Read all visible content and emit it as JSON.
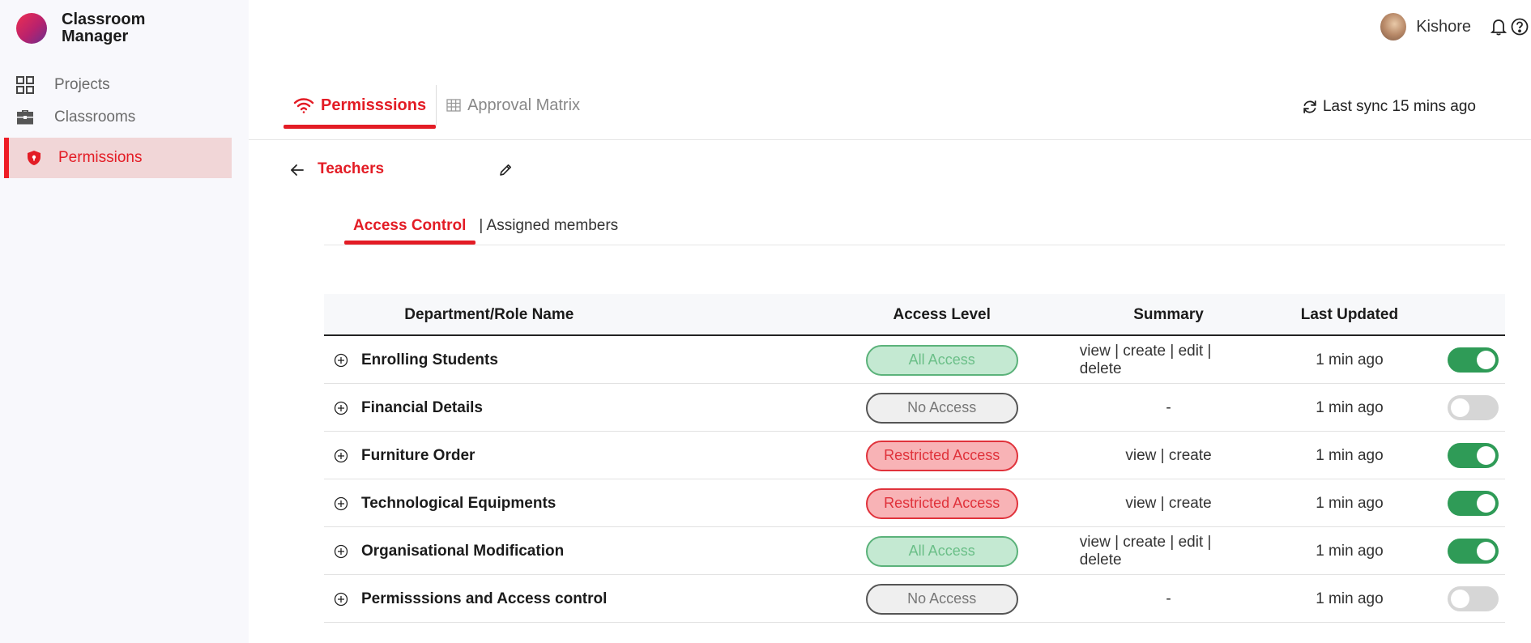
{
  "app": {
    "name": "Classroom Manager",
    "brand_color": "#e31c25"
  },
  "sidebar": {
    "items": [
      {
        "label": "Projects",
        "icon": "grid-icon",
        "active": false
      },
      {
        "label": "Classrooms",
        "icon": "briefcase-icon",
        "active": false
      },
      {
        "label": "Permissions",
        "icon": "shield-icon",
        "active": true
      }
    ]
  },
  "header": {
    "user_name": "Kishore",
    "icons": [
      "bell-icon",
      "help-icon"
    ]
  },
  "top_tabs": [
    {
      "label": "Permisssions",
      "icon": "wifi-icon",
      "active": true
    },
    {
      "label": "Approval Matrix",
      "icon": "table-icon",
      "active": false
    }
  ],
  "sync": {
    "text": "Last sync 15 mins ago"
  },
  "page": {
    "title": "Teachers"
  },
  "sub_tabs": [
    {
      "label": "Access Control",
      "active": true
    },
    {
      "label": "| Assigned members",
      "active": false
    }
  ],
  "table": {
    "columns": [
      "Department/Role Name",
      "Access Level",
      "Summary",
      "Last Updated"
    ],
    "rows": [
      {
        "name": "Enrolling Students",
        "access": "All Access",
        "access_type": "all",
        "summary": "view | create | edit | delete",
        "updated": "1 min ago",
        "enabled": true
      },
      {
        "name": "Financial Details",
        "access": "No Access",
        "access_type": "none",
        "summary": "-",
        "updated": "1 min ago",
        "enabled": false
      },
      {
        "name": "Furniture Order",
        "access": "Restricted Access",
        "access_type": "restricted",
        "summary": "view | create",
        "updated": "1 min ago",
        "enabled": true
      },
      {
        "name": "Technological Equipments",
        "access": "Restricted Access",
        "access_type": "restricted",
        "summary": "view | create",
        "updated": "1 min ago",
        "enabled": true
      },
      {
        "name": "Organisational Modification",
        "access": "All Access",
        "access_type": "all",
        "summary": "view | create | edit | delete",
        "updated": "1 min ago",
        "enabled": true
      },
      {
        "name": "Permisssions and Access control",
        "access": "No Access",
        "access_type": "none",
        "summary": "-",
        "updated": "1 min ago",
        "enabled": false
      }
    ]
  }
}
